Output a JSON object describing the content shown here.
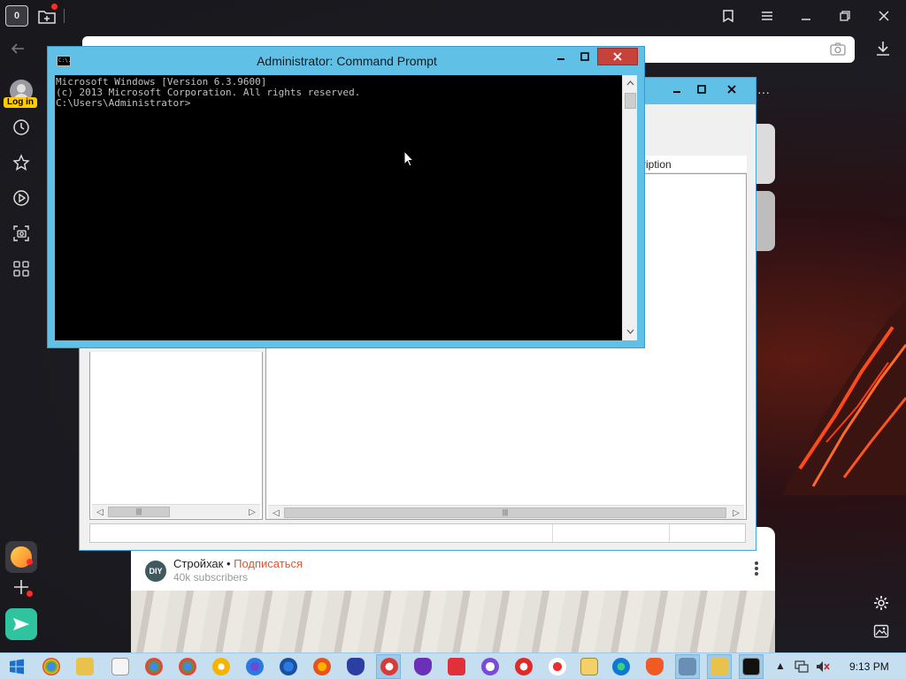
{
  "browser": {
    "tab_count": "0",
    "login_label": "Log in"
  },
  "cmd": {
    "title": "Administrator: Command Prompt",
    "icon_text": "C:\\.",
    "lines": [
      "Microsoft Windows [Version 6.3.9600]",
      "(c) 2013 Microsoft Corporation. All rights reserved.",
      "",
      "C:\\Users\\Administrator>"
    ]
  },
  "dialog": {
    "column_header": "cription"
  },
  "video_card": {
    "channel_logo": "DIY",
    "channel_name": "Стройхак",
    "separator": " • ",
    "subscribe_label": "Подписаться",
    "subscribers": "40k subscribers"
  },
  "taskbar": {
    "time": "9:13 PM"
  }
}
